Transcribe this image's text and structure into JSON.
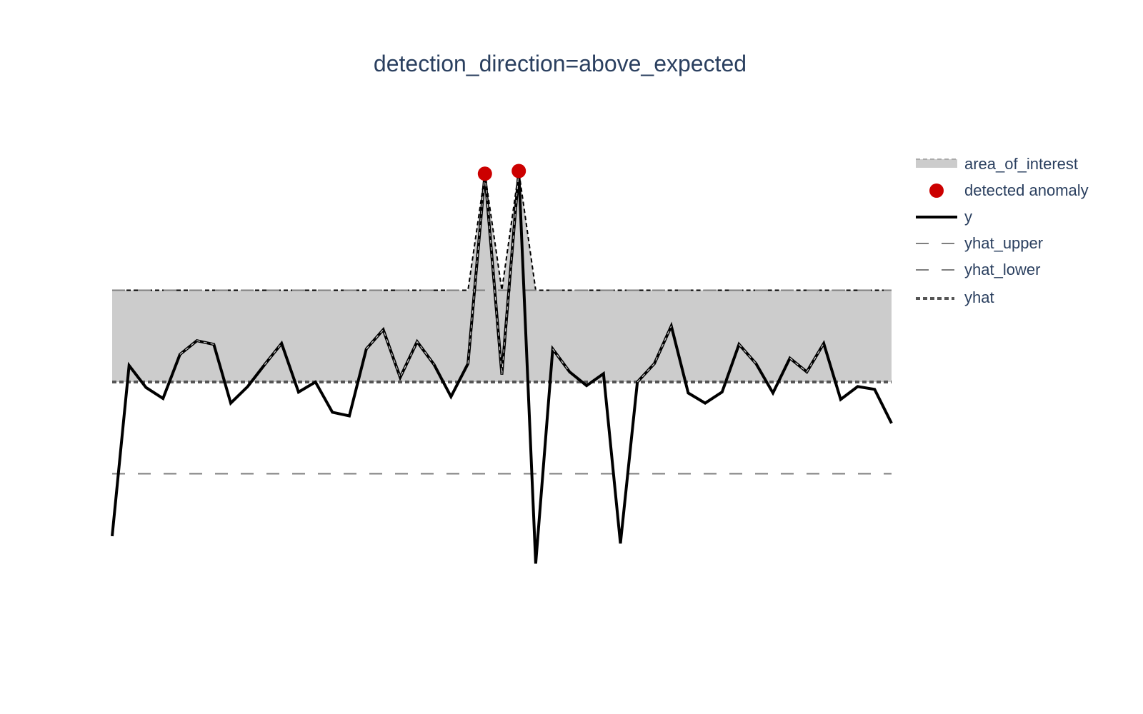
{
  "chart_data": {
    "type": "line",
    "title": "detection_direction=above_expected",
    "xlabel": "",
    "ylabel": "",
    "grid": false,
    "axes_visible": false,
    "legend_position": "right",
    "x": [
      0,
      1,
      2,
      3,
      4,
      5,
      6,
      7,
      8,
      9,
      10,
      11,
      12,
      13,
      14,
      15,
      16,
      17,
      18,
      19,
      20,
      21,
      22,
      23,
      24,
      25,
      26,
      27,
      28,
      29,
      30,
      31,
      32,
      33,
      34,
      35,
      36,
      37,
      38,
      39,
      40,
      41,
      42,
      43,
      44,
      45,
      46
    ],
    "ylim": [
      -2.1,
      2.6
    ],
    "series": [
      {
        "name": "y",
        "style": "solid",
        "color": "#000000",
        "values": [
          -1.68,
          0.18,
          -0.06,
          -0.18,
          0.3,
          0.45,
          0.41,
          -0.23,
          -0.05,
          0.19,
          0.42,
          -0.11,
          0.0,
          -0.33,
          -0.37,
          0.36,
          0.57,
          0.05,
          0.44,
          0.19,
          -0.16,
          0.2,
          2.27,
          0.08,
          2.3,
          -1.98,
          0.36,
          0.11,
          -0.04,
          0.09,
          -1.76,
          0.0,
          0.2,
          0.61,
          -0.12,
          -0.23,
          -0.11,
          0.41,
          0.2,
          -0.12,
          0.26,
          0.11,
          0.42,
          -0.19,
          -0.05,
          -0.08,
          -0.45
        ]
      },
      {
        "name": "yhat_upper",
        "style": "dash",
        "color": "#7f7f7f",
        "values": [
          1,
          1,
          1,
          1,
          1,
          1,
          1,
          1,
          1,
          1,
          1,
          1,
          1,
          1,
          1,
          1,
          1,
          1,
          1,
          1,
          1,
          1,
          1,
          1,
          1,
          1,
          1,
          1,
          1,
          1,
          1,
          1,
          1,
          1,
          1,
          1,
          1,
          1,
          1,
          1,
          1,
          1,
          1,
          1,
          1,
          1,
          1
        ]
      },
      {
        "name": "yhat_lower",
        "style": "dash",
        "color": "#7f7f7f",
        "values": [
          -1,
          -1,
          -1,
          -1,
          -1,
          -1,
          -1,
          -1,
          -1,
          -1,
          -1,
          -1,
          -1,
          -1,
          -1,
          -1,
          -1,
          -1,
          -1,
          -1,
          -1,
          -1,
          -1,
          -1,
          -1,
          -1,
          -1,
          -1,
          -1,
          -1,
          -1,
          -1,
          -1,
          -1,
          -1,
          -1,
          -1,
          -1,
          -1,
          -1,
          -1,
          -1,
          -1,
          -1,
          -1,
          -1,
          -1
        ]
      },
      {
        "name": "yhat",
        "style": "dot",
        "color": "#555555",
        "values": [
          0,
          0,
          0,
          0,
          0,
          0,
          0,
          0,
          0,
          0,
          0,
          0,
          0,
          0,
          0,
          0,
          0,
          0,
          0,
          0,
          0,
          0,
          0,
          0,
          0,
          0,
          0,
          0,
          0,
          0,
          0,
          0,
          0,
          0,
          0,
          0,
          0,
          0,
          0,
          0,
          0,
          0,
          0,
          0,
          0,
          0,
          0
        ]
      }
    ],
    "area_of_interest": {
      "name": "area_of_interest",
      "color": "#cccccc",
      "description": "filled between yhat and max(yhat_upper, y)"
    },
    "anomalies": {
      "name": "detected anomaly",
      "color": "#cc0000",
      "x": [
        22,
        24
      ],
      "y": [
        2.27,
        2.3
      ]
    },
    "legend": [
      {
        "label": "area_of_interest",
        "icon": "area-swatch"
      },
      {
        "label": "detected anomaly",
        "icon": "red-dot"
      },
      {
        "label": "y",
        "icon": "solid-line"
      },
      {
        "label": "yhat_upper",
        "icon": "dashed-line"
      },
      {
        "label": "yhat_lower",
        "icon": "dashed-line"
      },
      {
        "label": "yhat",
        "icon": "dotted-line"
      }
    ]
  }
}
